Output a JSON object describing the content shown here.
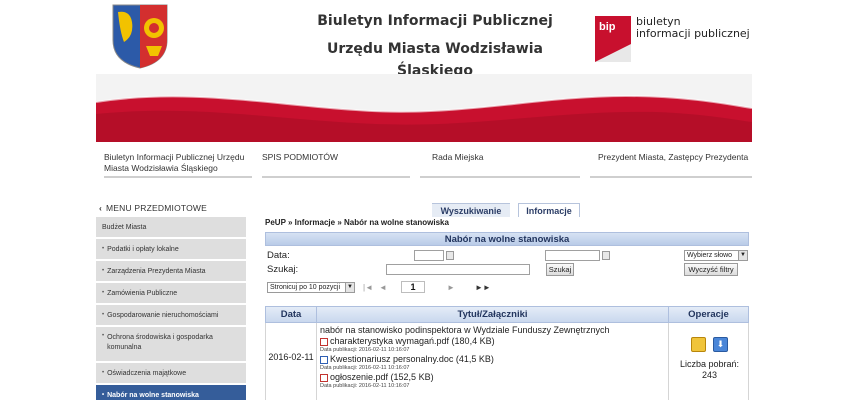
{
  "header": {
    "title_line1": "Biuletyn Informacji Publicznej",
    "title_line2": "Urzędu Miasta Wodzisławia Śląskiego",
    "bip_mark": "bip",
    "bip_line1": "biuletyn",
    "bip_line2": "informacji publicznej"
  },
  "topnav": {
    "items": [
      {
        "line1": "Biuletyn Informacji Publicznej Urzędu",
        "line2": "Miasta Wodzisławia Śląskiego"
      },
      {
        "line1": "SPIS PODMIOTÓW",
        "line2": ""
      },
      {
        "line1": "Rada Miejska",
        "line2": ""
      },
      {
        "line1": "Prezydent Miasta, Zastępcy Prezydenta",
        "line2": ""
      }
    ]
  },
  "sidebar": {
    "heading": "MENU PRZEDMIOTOWE",
    "items": [
      {
        "label": "Budżet Miasta",
        "bullet": ""
      },
      {
        "label": "Podatki i opłaty lokalne",
        "bullet": "•"
      },
      {
        "label": "Zarządzenia Prezydenta Miasta",
        "bullet": "•"
      },
      {
        "label": "Zamówienia Publiczne",
        "bullet": "•"
      },
      {
        "label": "Gospodarowanie nieruchomościami",
        "bullet": "•"
      },
      {
        "label": "Ochrona środowiska i gospodarka komunalna",
        "bullet": "•"
      },
      {
        "label": "Oświadczenia majątkowe",
        "bullet": "•"
      },
      {
        "label": "Nabór na wolne stanowiska",
        "bullet": "•"
      }
    ]
  },
  "tabs": {
    "search": "Wyszukiwanie",
    "info": "Informacje"
  },
  "breadcrumb": "PeUP » Informacje » Nabór na wolne stanowiska",
  "panel": {
    "title": "Nabór na wolne stanowiska",
    "date_label": "Data:",
    "search_label": "Szukaj:",
    "search_button": "Szukaj",
    "keyword_select": "Wybierz słowo",
    "clear_button": "Wyczyść filtry",
    "page_size": "Stronicuj po 10 pozycji",
    "pager_first": "|◄",
    "pager_prev": "◄",
    "current_page": "1",
    "pager_next": "►",
    "pager_last": "►►"
  },
  "table": {
    "col_date": "Data",
    "col_title": "Tytuł/Załączniki",
    "col_ops": "Operacje",
    "rows": [
      {
        "date": "2016-02-11",
        "title": "nabór na stanowisko podinspektora w Wydziale Funduszy Zewnętrznych",
        "attachments": [
          {
            "name": "charakterystyka wymagań.pdf (180,4 KB)",
            "pub": "Data publikacji: 2016-02-11 10:16:07",
            "type": "pdf"
          },
          {
            "name": "Kwestionariusz personalny.doc (41,5 KB)",
            "pub": "Data publikacji: 2016-02-11 10:16:07",
            "type": "doc"
          },
          {
            "name": "ogłoszenie.pdf (152,5 KB)",
            "pub": "Data publikacji: 2016-02-11 10:16:07",
            "type": "pdf"
          }
        ],
        "downloads_label": "Liczba pobrań:",
        "downloads": "243"
      }
    ]
  },
  "colors": {
    "active_menu": "#355d9a",
    "banner_red": "#c8102e",
    "panel_header": "#c9d8ee"
  }
}
